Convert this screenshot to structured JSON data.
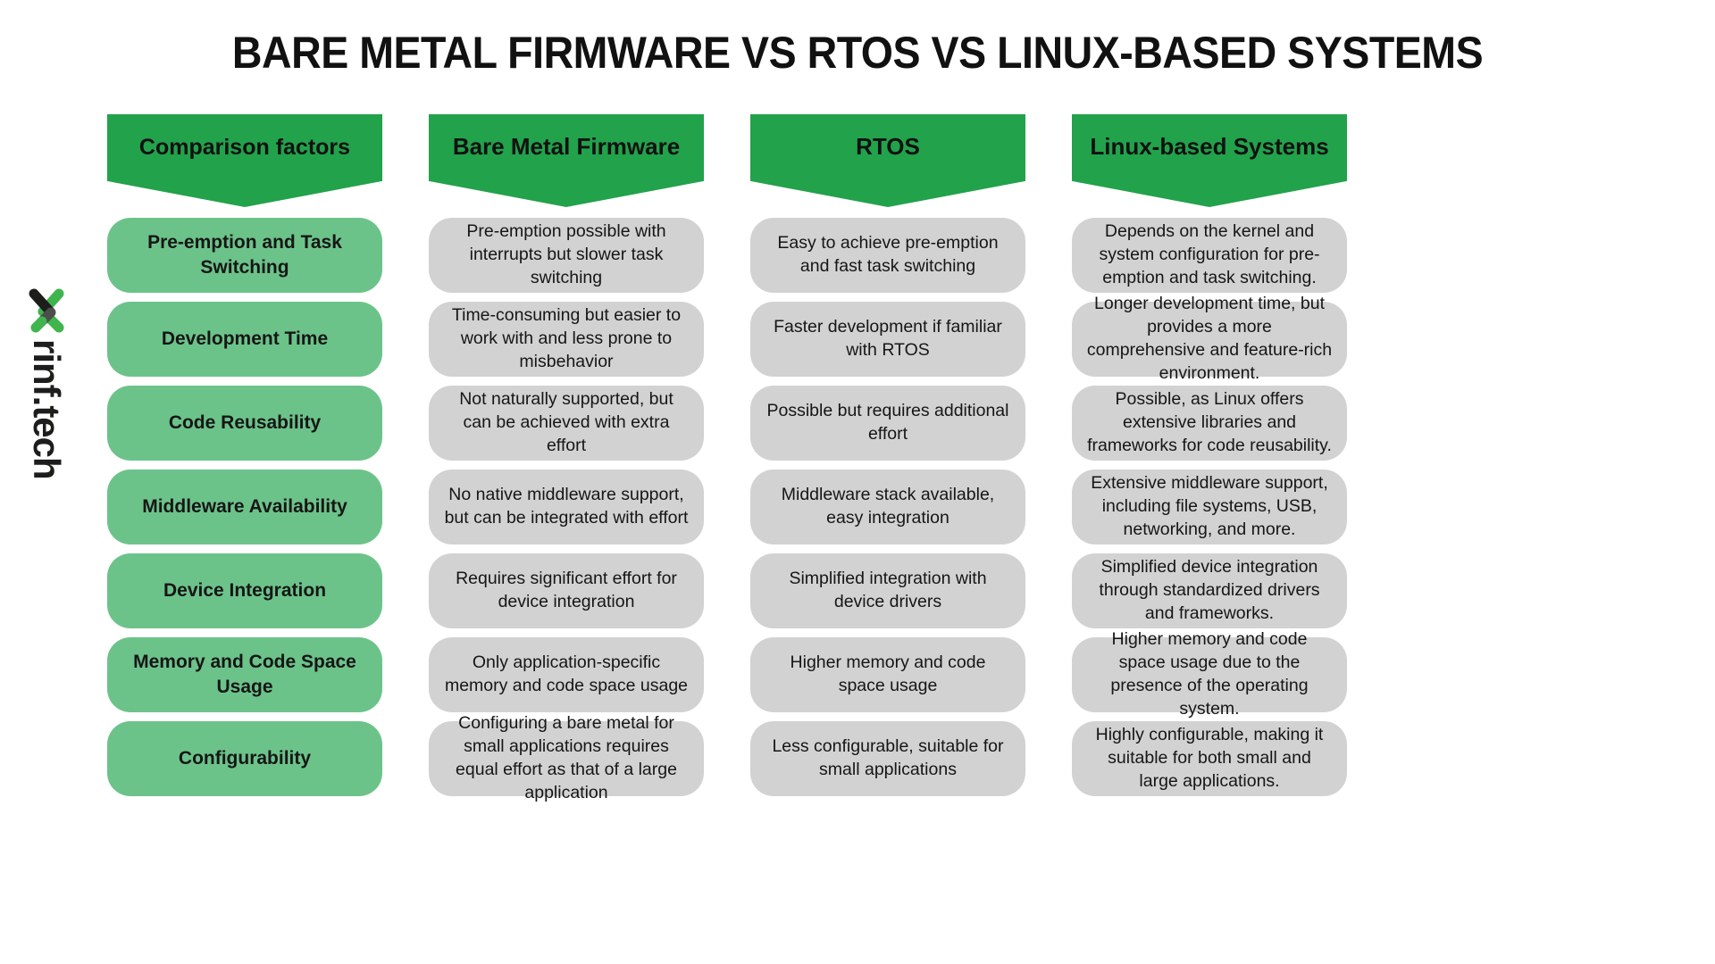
{
  "page": {
    "title": "BARE METAL FIRMWARE VS RTOS VS LINUX-BASED SYSTEMS",
    "background_color": "#ffffff"
  },
  "brand": {
    "name": "rinf",
    "suffix": ".tech",
    "logo_icon": "rinf-x-logo",
    "colors": {
      "green": "#3fb54d",
      "dark": "#1d1d1b",
      "gray": "#4d4d4d"
    }
  },
  "theme": {
    "header_green": "#22a24b",
    "factor_green": "#6cc38a",
    "cell_gray": "#d2d2d2",
    "text_dark": "#161616"
  },
  "table": {
    "columns": [
      {
        "header": "Comparison factors",
        "type": "factors"
      },
      {
        "header": "Bare Metal Firmware",
        "type": "data"
      },
      {
        "header": "RTOS",
        "type": "data"
      },
      {
        "header": "Linux-based Systems",
        "type": "data"
      }
    ],
    "rows": [
      {
        "factor": "Pre-emption and Task Switching",
        "bare_metal": "Pre-emption possible with interrupts but slower task switching",
        "rtos": "Easy to achieve pre-emption and fast task switching",
        "linux": "Depends on the kernel and system configuration for pre-emption and task switching."
      },
      {
        "factor": "Development Time",
        "bare_metal": "Time-consuming but easier to work with and less prone to misbehavior",
        "rtos": "Faster development if familiar with RTOS",
        "linux": "Longer development time, but provides a more comprehensive and feature-rich environment."
      },
      {
        "factor": "Code Reusability",
        "bare_metal": "Not naturally supported, but can be achieved with extra effort",
        "rtos": "Possible but requires additional effort",
        "linux": "Possible, as Linux offers extensive libraries and frameworks for code reusability."
      },
      {
        "factor": "Middleware Availability",
        "bare_metal": "No native middleware support, but can be integrated with effort",
        "rtos": "Middleware stack available, easy integration",
        "linux": "Extensive middleware support, including file systems, USB, networking, and more."
      },
      {
        "factor": "Device Integration",
        "bare_metal": "Requires significant effort for device integration",
        "rtos": "Simplified integration with device drivers",
        "linux": "Simplified device integration through standardized drivers and frameworks."
      },
      {
        "factor": "Memory and Code Space Usage",
        "bare_metal": "Only application-specific memory and code space usage",
        "rtos": "Higher memory and code space usage",
        "linux": "Higher memory and code space usage due to the presence of the operating system."
      },
      {
        "factor": "Configurability",
        "bare_metal": "Configuring a bare metal for small applications requires equal effort as that of a large application",
        "rtos": "Less configurable, suitable for small applications",
        "linux": "Highly configurable, making it suitable for both small and large applications."
      }
    ]
  }
}
